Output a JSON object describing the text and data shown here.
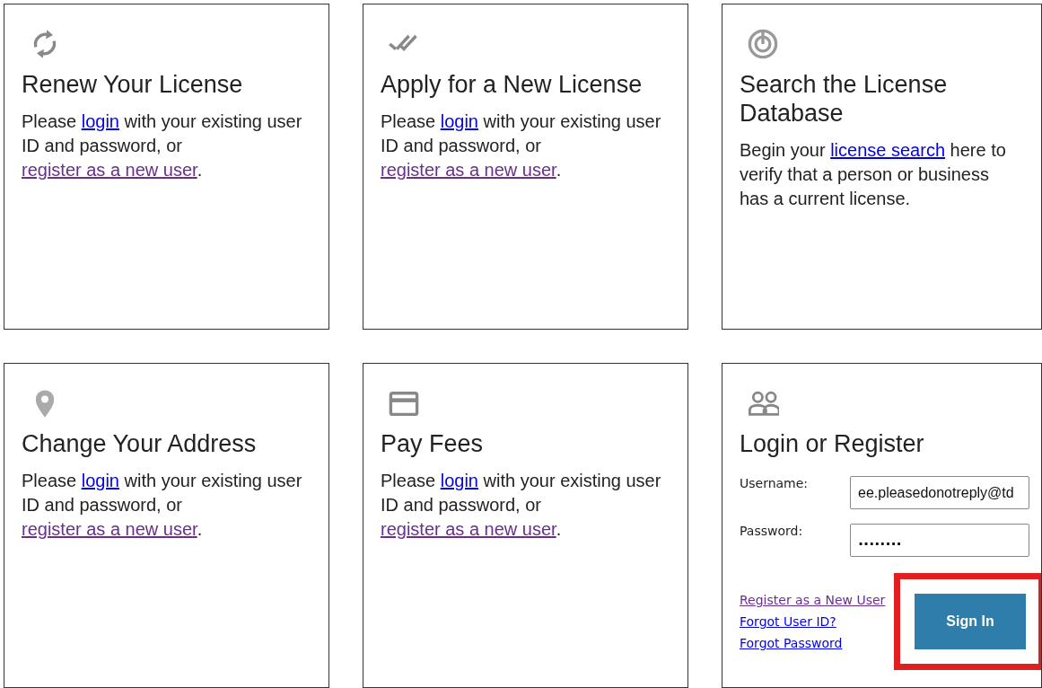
{
  "cards": [
    {
      "kind": "info",
      "title": "Renew Your License",
      "description": [
        {
          "text": "Please "
        },
        {
          "text": "login",
          "link": true,
          "visited": false
        },
        {
          "text": " with your existing user ID and password, or "
        },
        {
          "text": "register as a new user",
          "link": true,
          "visited": true
        },
        {
          "text": "."
        }
      ]
    },
    {
      "kind": "info",
      "title": "Apply for a New License",
      "description": [
        {
          "text": "Please "
        },
        {
          "text": "login",
          "link": true,
          "visited": false
        },
        {
          "text": " with your existing user ID and password, or "
        },
        {
          "text": "register as a new user",
          "link": true,
          "visited": true
        },
        {
          "text": "."
        }
      ]
    },
    {
      "kind": "info",
      "title": "Search the License Database",
      "description": [
        {
          "text": "Begin your "
        },
        {
          "text": "license search",
          "link": true,
          "visited": false
        },
        {
          "text": " here to verify that a person or business has a current license."
        }
      ]
    },
    {
      "kind": "info",
      "title": "Change Your Address",
      "description": [
        {
          "text": "Please "
        },
        {
          "text": "login",
          "link": true,
          "visited": false
        },
        {
          "text": " with your existing user ID and password, or "
        },
        {
          "text": "register as a new user",
          "link": true,
          "visited": true
        },
        {
          "text": "."
        }
      ]
    },
    {
      "kind": "info",
      "title": "Pay Fees",
      "description": [
        {
          "text": "Please "
        },
        {
          "text": "login",
          "link": true,
          "visited": false
        },
        {
          "text": " with your existing user ID and password, or "
        },
        {
          "text": "register as a new user",
          "link": true,
          "visited": true
        },
        {
          "text": "."
        }
      ]
    },
    {
      "kind": "login",
      "title": "Login or Register",
      "fields": [
        {
          "label": "Username:",
          "value": "ee.pleasedonotreply@td",
          "masked": false
        },
        {
          "label": "Password:",
          "value": "........",
          "masked": true
        }
      ],
      "links": [
        {
          "text": "Register as a New User",
          "visited": true
        },
        {
          "text": "Forgot User ID?",
          "visited": false
        },
        {
          "text": "Forgot Password",
          "visited": false
        }
      ],
      "button": {
        "label": "Sign In",
        "highlighted": true
      }
    }
  ]
}
